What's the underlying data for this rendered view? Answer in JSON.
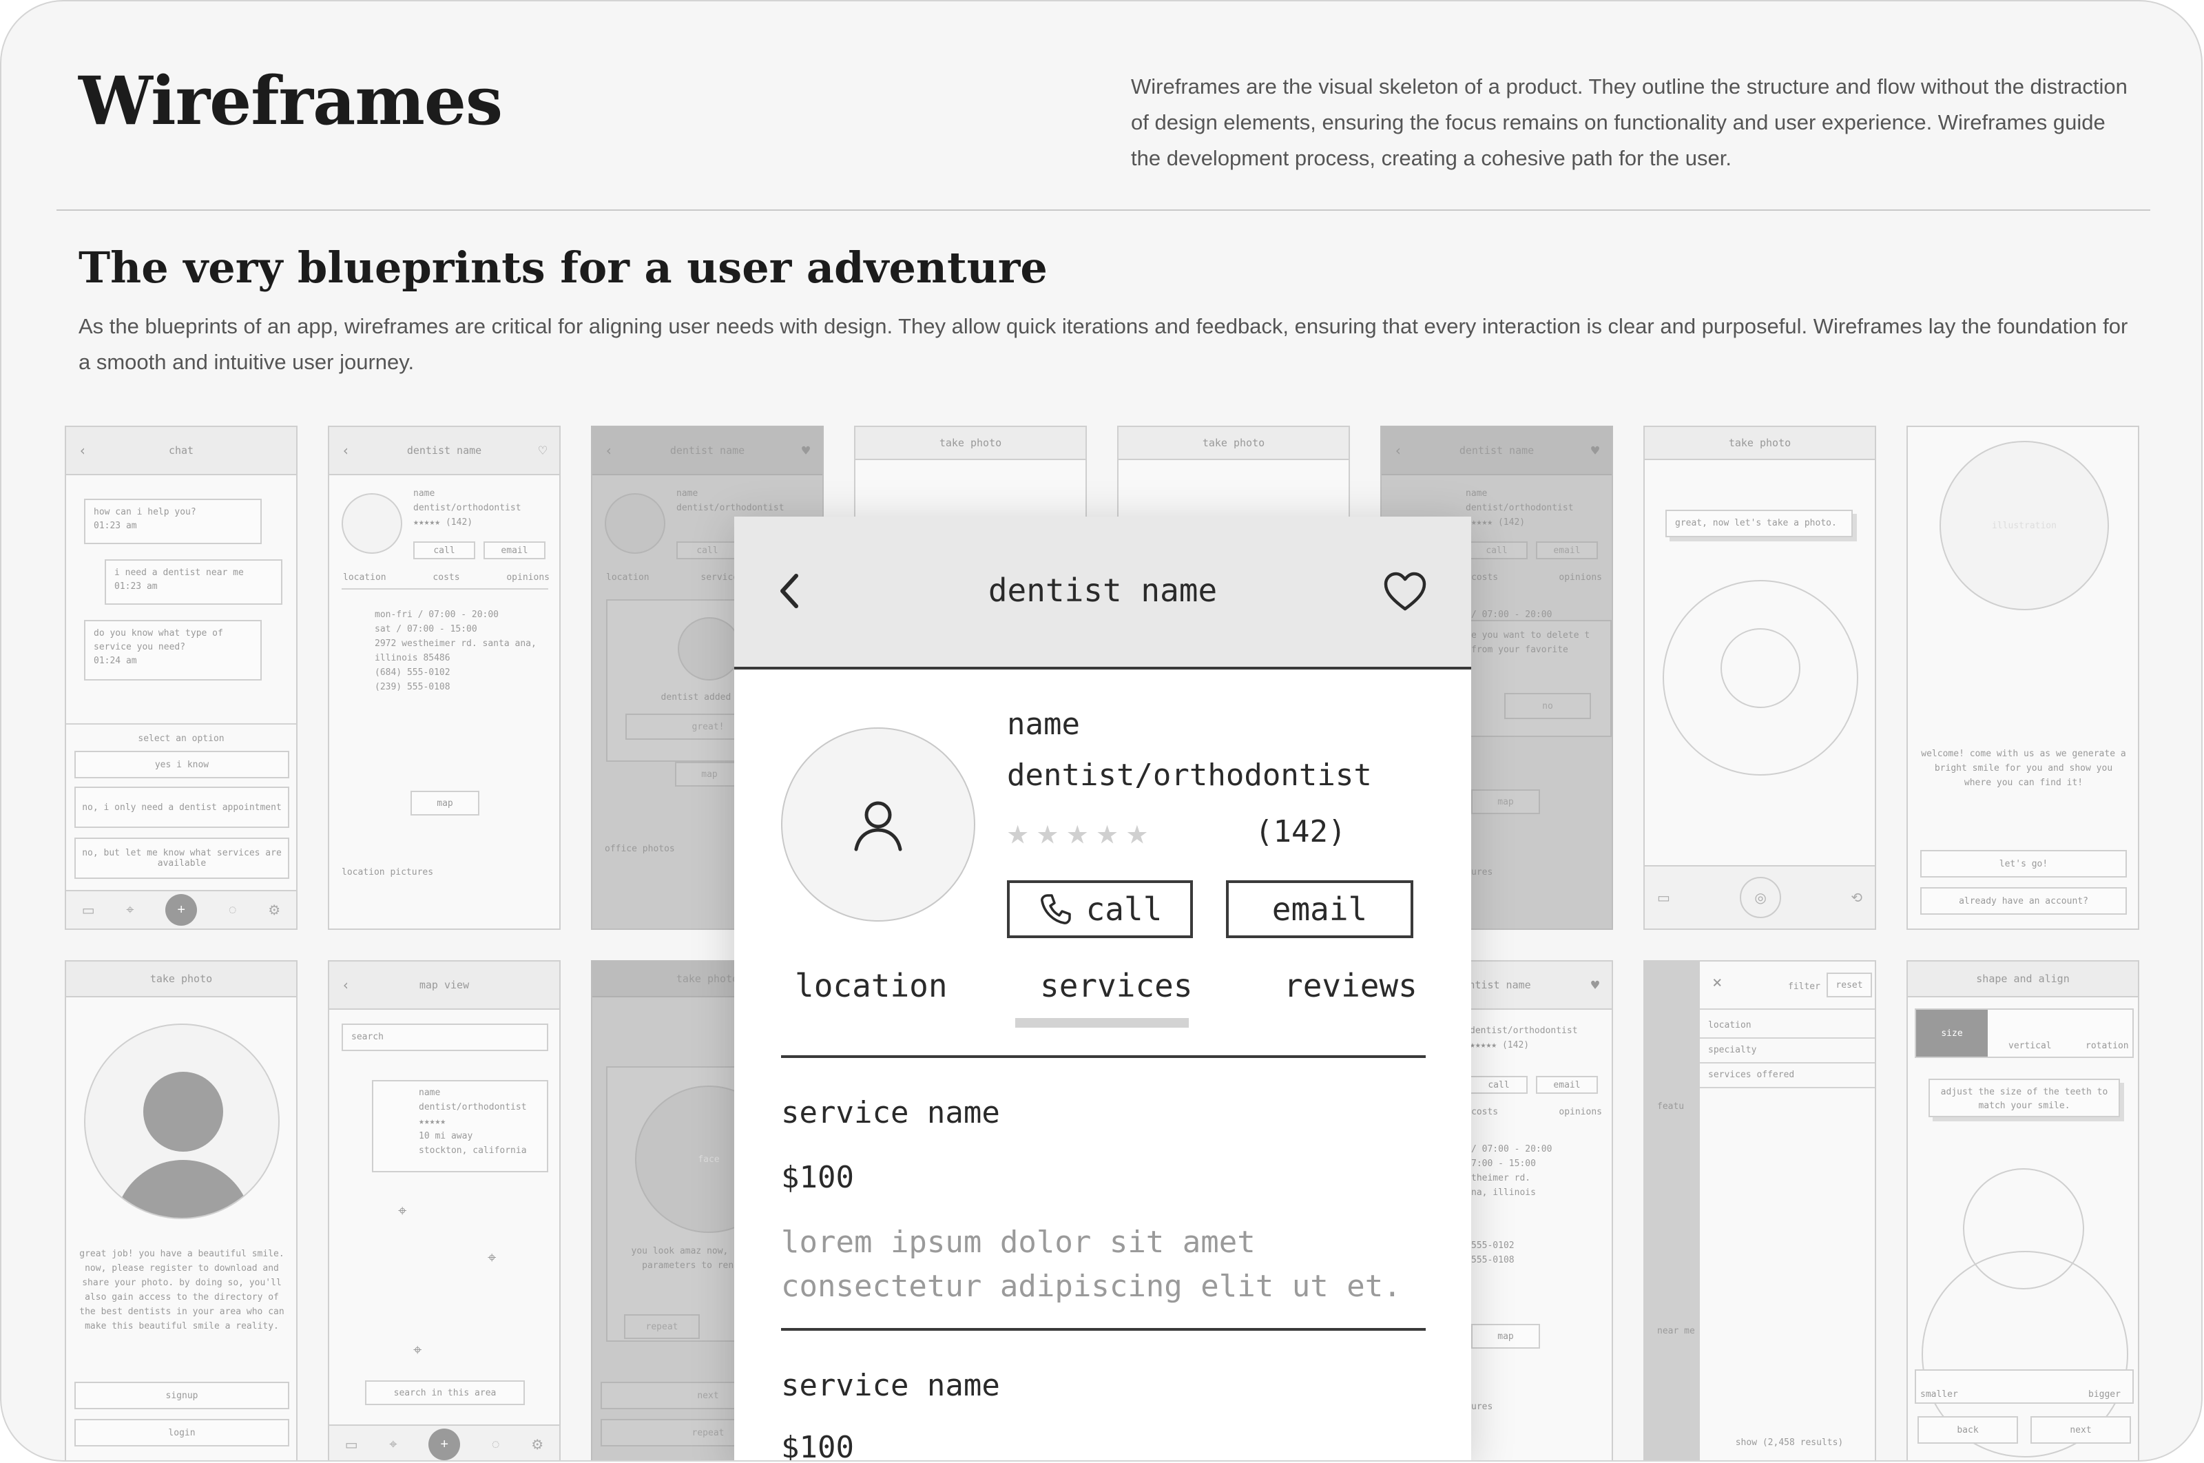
{
  "header": {
    "title": "Wireframes",
    "intro": "Wireframes are the visual skeleton of a product. They outline the structure and flow without the distraction of design elements, ensuring the focus remains on functionality and user experience. Wireframes guide the development process, creating a cohesive path for the user."
  },
  "section": {
    "title": "The very blueprints for a user adventure",
    "body": "As the blueprints of an app, wireframes are critical for aligning user needs with design. They allow quick iterations and feedback, ensuring that every interaction is clear and purposeful. Wireframes lay the foundation for a smooth and intuitive user journey."
  },
  "thumbs": {
    "chat": {
      "title": "chat",
      "msg1": "how can i help you?",
      "msg1_time": "01:23 am",
      "msg2": "i need a dentist near me",
      "msg2_time": "01:23 am",
      "msg3": "do you know what type of service you need?",
      "msg3_time": "01:24 am",
      "prompt": "select an option",
      "opt1": "yes i know",
      "opt2": "no, i only need a dentist appointment",
      "opt3": "no, but let me know what services are available"
    },
    "profile": {
      "title": "dentist name",
      "name": "name",
      "role": "dentist/orthodontist",
      "count": "(142)",
      "call": "call",
      "email": "email",
      "tab1": "location",
      "tab2": "costs",
      "tab3": "opinions",
      "hours1": "mon-fri / 07:00 - 20:00",
      "hours2": "sat / 07:00 - 15:00",
      "address": "2972 westheimer rd. santa ana, illinois 85486",
      "phone1": "(684) 555-0102",
      "phone2": "(239) 555-0108",
      "map": "map",
      "pictures": "location pictures"
    },
    "favorite": {
      "title": "dentist name",
      "name": "name",
      "role": "dentist/orthodontist",
      "call": "call",
      "tab1": "location",
      "tab2": "services",
      "added": "dentist added to f",
      "great": "great!",
      "map": "map",
      "photos": "office photos"
    },
    "take1": {
      "title": "take photo"
    },
    "take2": {
      "title": "take photo"
    },
    "delete": {
      "title": "dentist name",
      "name": "name",
      "role": "dentist/orthodontist",
      "count": "(142)",
      "call": "call",
      "email": "email",
      "tab2": "costs",
      "tab3": "opinions",
      "hours": "/ 07:00 - 20:00",
      "confirm": "e you want to delete t from your favorite",
      "no": "no",
      "map": "map",
      "pictures": "ures"
    },
    "take3": {
      "title": "take photo",
      "hint": "great, now let's take a photo."
    },
    "welcome": {
      "illustration": "illustration",
      "text": "welcome! come with us as we generate a bright smile for you and show you where you can find it!",
      "go": "let's go!",
      "account": "already have an account?"
    },
    "great": {
      "title": "take photo",
      "text": "great job! you have a beautiful smile. now, please register to download and share your photo. by doing so, you'll also gain access to the directory of the best dentists in your area who can make this beautiful smile a reality.",
      "signup": "signup",
      "login": "login"
    },
    "map": {
      "title": "map view",
      "search": "search",
      "name": "name",
      "role": "dentist/orthodontist",
      "away": "10 mi away",
      "city": "stockton, california",
      "area": "search in this area"
    },
    "amazing": {
      "title": "take photo",
      "face": "face",
      "text": "you look amaz now, lets adjus parameters to rend smile.",
      "repeat": "repeat",
      "next": "next",
      "repeat2": "repeat"
    },
    "profile2": {
      "title": "entist name",
      "role": "dentist/orthodontist",
      "count": "(142)",
      "call": "call",
      "email": "email",
      "tab2": "costs",
      "tab3": "opinions",
      "hours1": "/ 07:00 - 20:00",
      "hours2": "7:00 - 15:00",
      "addr1": "theimer rd.",
      "addr2": "na, illinois",
      "phone1": "555-0102",
      "phone2": "555-0108",
      "map": "map",
      "pictures": "ures"
    },
    "filter": {
      "title": "filter",
      "reset": "reset",
      "f1": "location",
      "f2": "specialty",
      "f3": "services offered",
      "feature": "featu",
      "near": "near me",
      "show": "show (2,458 results)"
    },
    "shape": {
      "title": "shape and align",
      "seg1": "size",
      "seg2": "vertical",
      "seg3": "rotation",
      "hint": "adjust the size of the teeth to match your smile.",
      "smaller": "smaller",
      "bigger": "bigger",
      "back": "back",
      "next": "next"
    }
  },
  "detail": {
    "title": "dentist name",
    "name": "name",
    "role": "dentist/orthodontist",
    "rating_stars": 0,
    "rating_max": 5,
    "count": "(142)",
    "call": "call",
    "email": "email",
    "tabs": [
      "location",
      "services",
      "reviews"
    ],
    "active_tab": "services",
    "services": [
      {
        "name": "service name",
        "price": "$100",
        "desc": "lorem ipsum dolor sit amet consectetur adipiscing elit ut et."
      },
      {
        "name": "service name",
        "price": "$100"
      }
    ]
  }
}
